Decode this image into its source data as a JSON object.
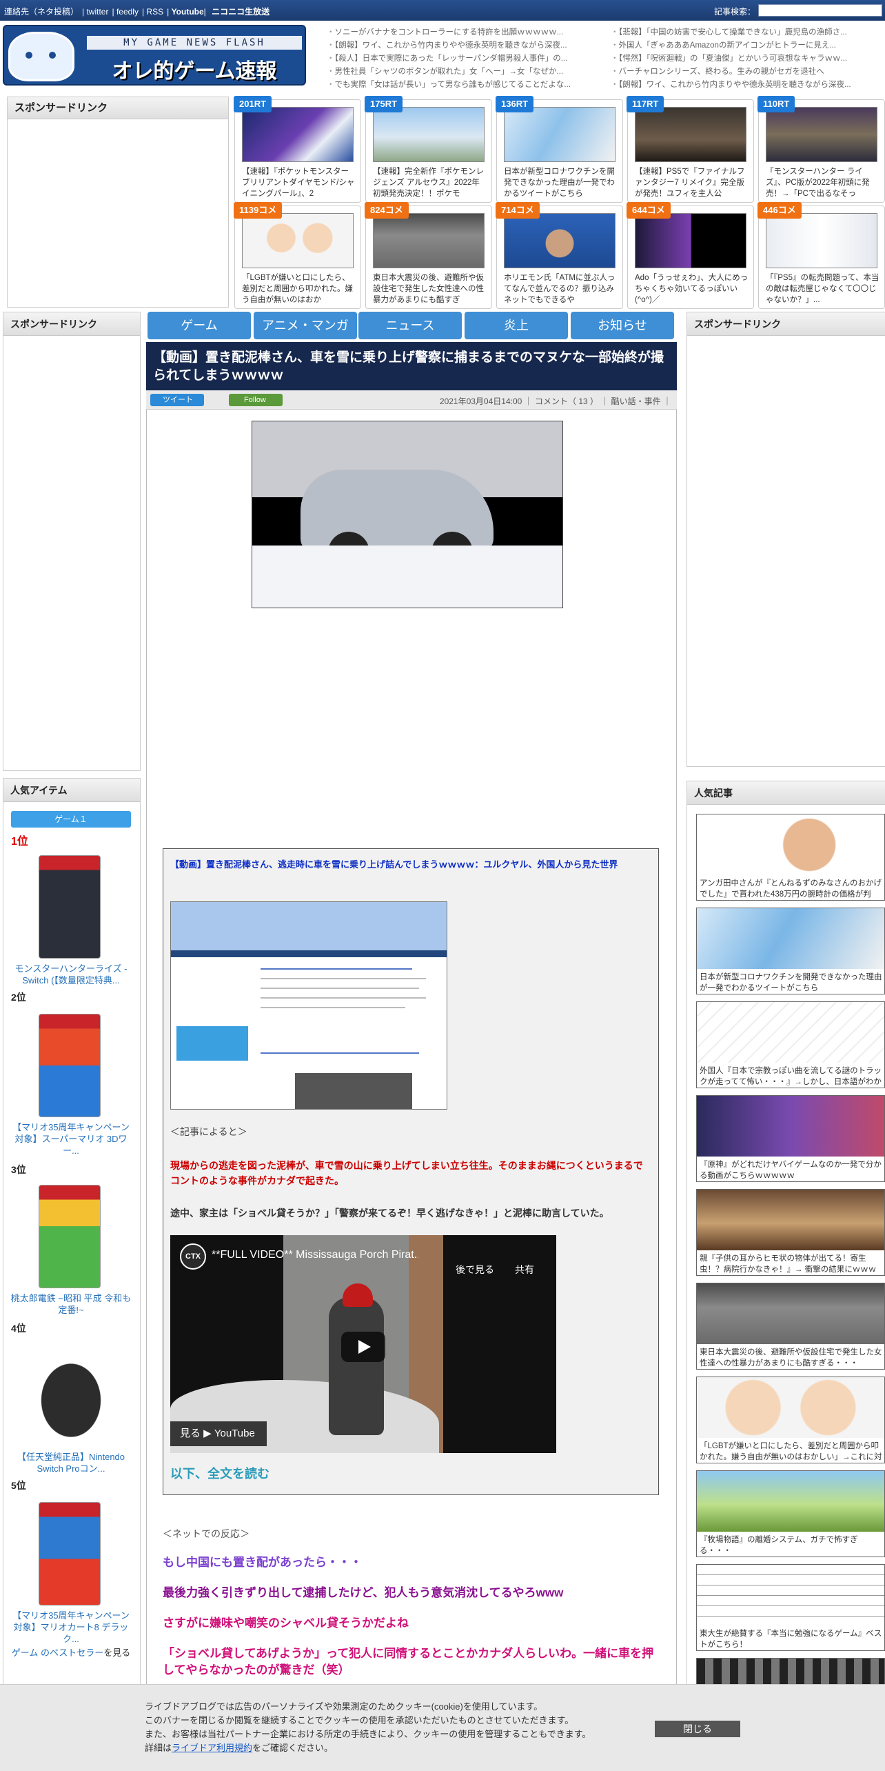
{
  "topbar": {
    "links": [
      "連絡先（ネタ投稿）",
      "twitter",
      "feedly",
      "RSS",
      "Youtube",
      "ニコニコ生放送"
    ],
    "search_label": "記事検索："
  },
  "logo": {
    "sub": "MY GAME NEWS FLASH",
    "main": "オレ的ゲーム速報@JIN"
  },
  "headlines_left": [
    "ソニーがバナナをコントローラーにする特許を出願ｗｗｗｗｗ...",
    "【朗報】ワイ、これから竹内まりやや德永英明を聴きながら深夜...",
    "【殺人】日本で実際にあった「レッサーパンダ帽男殺人事件」の...",
    "男性社員「シャツのボタンが取れた」女「へー」→女「なぜか...",
    "でも実際「女は話が長い」って男なら誰もが感じてることだよな..."
  ],
  "headlines_right": [
    "【悲報】「中国の妨害で安心して操業できない」鹿児島の漁師さ...",
    "外国人「ぎゃあああAmazonの新アイコンがヒトラーに見え...",
    "【愕然】「呪術廻戦」の「夏油傑」とかいう可哀想なキャラｗｗ...",
    "バーチャロンシリーズ、終わる。生みの親がセガを退社へ",
    "【朗報】ワイ、これから竹内まりやや德永英明を聴きながら深夜..."
  ],
  "sponsor_label": "スポンサードリンク",
  "rt_cards": [
    {
      "badge": "201RT",
      "title": "【速報】『ポケットモンスター ブリリアントダイヤモンド/シャイニングパール』、2",
      "kind": "blue"
    },
    {
      "badge": "175RT",
      "title": "【速報】完全新作『ポケモンレジェンズ アルセウス』2022年初頭発売決定！！ポケモ",
      "kind": "blue"
    },
    {
      "badge": "136RT",
      "title": "日本が新型コロナワクチンを開発できなかった理由が一発でわかるツイートがこちら",
      "kind": "blue"
    },
    {
      "badge": "117RT",
      "title": "【速報】PS5で『ファイナルファンタジー7 リメイク』完全版が発売！ユフィを主人公",
      "kind": "blue"
    },
    {
      "badge": "110RT",
      "title": "『モンスターハンター ライズ』、PC版が2022年初頭に発売！→「PCで出るなそっ",
      "kind": "blue"
    },
    {
      "badge": "1139コメ",
      "title": "「LGBTが嫌いと口にしたら、差別だと周囲から叩かれた。嫌う自由が無いのはおか",
      "kind": "orange"
    },
    {
      "badge": "824コメ",
      "title": "東日本大震災の後、避難所や仮設住宅で発生した女性達への性暴力があまりにも酷すぎ",
      "kind": "orange"
    },
    {
      "badge": "714コメ",
      "title": "ホリエモン氏「ATMに並ぶ人ってなんで並んでるの？振り込みネットでもできるや",
      "kind": "orange"
    },
    {
      "badge": "644コメ",
      "title": "Ado「うっせぇわ」、大人にめっちゃくちゃ効いてるっぽいい(^o^)／",
      "kind": "orange"
    },
    {
      "badge": "446コメ",
      "title": "「『PS5』の転売問題って、本当の敵は転売屋じゃなくて〇〇じゃないか？」...",
      "kind": "orange"
    }
  ],
  "nav_tabs": [
    "ゲーム",
    "アニメ・マンガ",
    "ニュース",
    "炎上",
    "お知らせ"
  ],
  "article": {
    "title": "【動画】置き配泥棒さん、車を雪に乗り上げ警察に捕まるまでのマヌケな一部始終が撮られてしまうｗｗｗｗ",
    "tweet": "ツイート",
    "follow": "Follow",
    "meta": "2021年03月04日14:00 ｜ コメント（ 13 ） ｜ 酷い話・事件 ｜",
    "quote_link": "【動画】置き配泥棒さん、逃走時に車を雪に乗り上げ詰んでしまうｗｗｗｗ：ユルクヤル、外国人から見た世界",
    "quote_note": "＜記事によると＞",
    "quote_red": "現場からの逃走を図った泥棒が、車で雪の山に乗り上げてしまい立ち往生。そのままお縄につくというまるでコントのような事件がカナダで起きた。",
    "quote_dark": "途中、家主は「ショベル貸そうか？」「警察が来てるぞ！早く逃げなきゃ！」と泥棒に助言していた。",
    "video_title": "**FULL VIDEO** Mississauga Porch Pirat...",
    "video_channel": "CTX",
    "video_later": "後で見る",
    "video_share": "共有",
    "video_watch": "見る  ▶ YouTube",
    "readmore": "以下、全文を読む",
    "net_reaction": "＜ネットでの反応＞",
    "comments": [
      {
        "text": "もし中国にも置き配があったら・・・",
        "color": "#7b3fd0"
      },
      {
        "text": "最後力強く引きずり出して逮捕したけど、犯人もう意気消沈してるやろwww",
        "color": "#8a1090"
      },
      {
        "text": "さすがに嫌味や嘲笑のシャベル貸そうかだよね",
        "color": "#d0107a"
      },
      {
        "text": "「ショベル貸してあげようか」って犯人に同情するとことかカナダ人らしいわ。一緒に車を押してやらなかったのが驚きだ（笑）",
        "color": "#d0107a"
      }
    ]
  },
  "left_side": {
    "popular_items_label": "人気アイテム",
    "ranking_tab": "ゲーム１",
    "ranks": [
      {
        "no": "1位",
        "name": "モンスターハンターライズ -Switch (【数量限定特典..."
      },
      {
        "no": "2位",
        "name": "【マリオ35周年キャンペーン対象】スーパーマリオ 3Dワー..."
      },
      {
        "no": "3位",
        "name": "桃太郎電鉄 ~昭和 平成 令和も定番!~"
      },
      {
        "no": "4位",
        "name": "【任天堂純正品】Nintendo Switch Proコン..."
      },
      {
        "no": "5位",
        "name": "【マリオ35周年キャンペーン対象】マリオカート8 デラック..."
      }
    ],
    "bestseller_link": "ゲーム のベストセラー",
    "bestseller_tail": "を見る"
  },
  "right_side": {
    "popular_articles_label": "人気記事",
    "articles": [
      "アンガ田中さんが『とんねるずのみなさんのおかげでした』で貰われた438万円の腕時計の価格が判",
      "日本が新型コロナワクチンを開発できなかった理由が一発でわかるツイートがこちら",
      "外国人『日本で宗教っぽい曲を流してる謎のトラックが走ってて怖い・・・』→しかし、日本語がわか",
      "『原神』がどれだけヤバイゲームなのか一発で分かる動画がこちらｗｗｗｗｗ",
      "親『子供の耳からヒモ状の物体が出てる！寄生虫！？病院行かなきゃ！』→ 衝撃の結果にｗｗｗ",
      "東日本大震災の後、避難所や仮設住宅で発生した女性達への性暴力があまりにも酷すぎる・・・",
      "「LGBTが嫌いと口にしたら、差別だと周囲から叩かれた。嫌う自由が無いのはおかしい」→これに対",
      "『牧場物語』の離婚システム、ガチで怖すぎる・・・",
      "東大生が絶賛する『本当に勉強になるゲーム』ベストがこちら！"
    ]
  },
  "cookie": {
    "lines": [
      "ライブドアブログでは広告のパーソナライズや効果測定のためクッキー(cookie)を使用しています。",
      "このバナーを閉じるか閲覧を継続することでクッキーの使用を承認いただいたものとさせていただきます。",
      "また、お客様は当社パートナー企業における所定の手続きにより、クッキーの使用を管理することもできます。"
    ],
    "detail_prefix": "詳細は",
    "detail_link": "ライブドア利用規約",
    "detail_suffix": "をご確認ください。",
    "close": "閉じる"
  },
  "colors": {
    "nav_tab": "#3e8fd6",
    "title_bar": "#17284e",
    "rt_badge": "#1e7ad6",
    "comment_badge": "#f07014"
  }
}
